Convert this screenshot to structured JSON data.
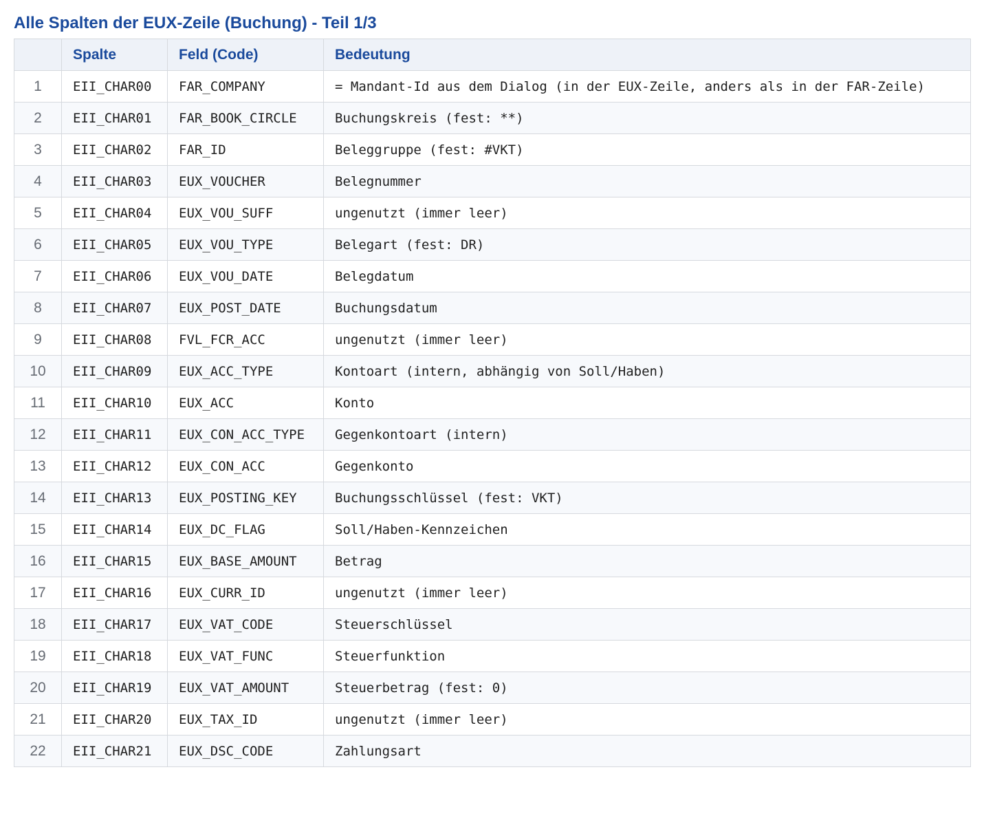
{
  "title": "Alle Spalten der EUX-Zeile (Buchung) - Teil 1/3",
  "table": {
    "headers": [
      "",
      "Spalte",
      "Feld (Code)",
      "Bedeutung"
    ],
    "rows": [
      {
        "num": "1",
        "spalte": "EII_CHAR00",
        "feld": "FAR_COMPANY",
        "bedeutung": "= Mandant-Id aus dem Dialog (in der EUX-Zeile, anders als in der FAR-Zeile)"
      },
      {
        "num": "2",
        "spalte": "EII_CHAR01",
        "feld": "FAR_BOOK_CIRCLE",
        "bedeutung": "Buchungskreis (fest: **)"
      },
      {
        "num": "3",
        "spalte": "EII_CHAR02",
        "feld": "FAR_ID",
        "bedeutung": "Beleggruppe (fest: #VKT)"
      },
      {
        "num": "4",
        "spalte": "EII_CHAR03",
        "feld": "EUX_VOUCHER",
        "bedeutung": "Belegnummer"
      },
      {
        "num": "5",
        "spalte": "EII_CHAR04",
        "feld": "EUX_VOU_SUFF",
        "bedeutung": "ungenutzt (immer leer)"
      },
      {
        "num": "6",
        "spalte": "EII_CHAR05",
        "feld": "EUX_VOU_TYPE",
        "bedeutung": "Belegart (fest: DR)"
      },
      {
        "num": "7",
        "spalte": "EII_CHAR06",
        "feld": "EUX_VOU_DATE",
        "bedeutung": "Belegdatum"
      },
      {
        "num": "8",
        "spalte": "EII_CHAR07",
        "feld": "EUX_POST_DATE",
        "bedeutung": "Buchungsdatum"
      },
      {
        "num": "9",
        "spalte": "EII_CHAR08",
        "feld": "FVL_FCR_ACC",
        "bedeutung": "ungenutzt (immer leer)"
      },
      {
        "num": "10",
        "spalte": "EII_CHAR09",
        "feld": "EUX_ACC_TYPE",
        "bedeutung": "Kontoart (intern, abhängig von Soll/Haben)"
      },
      {
        "num": "11",
        "spalte": "EII_CHAR10",
        "feld": "EUX_ACC",
        "bedeutung": "Konto"
      },
      {
        "num": "12",
        "spalte": "EII_CHAR11",
        "feld": "EUX_CON_ACC_TYPE",
        "bedeutung": "Gegenkontoart (intern)"
      },
      {
        "num": "13",
        "spalte": "EII_CHAR12",
        "feld": "EUX_CON_ACC",
        "bedeutung": "Gegenkonto"
      },
      {
        "num": "14",
        "spalte": "EII_CHAR13",
        "feld": "EUX_POSTING_KEY",
        "bedeutung": "Buchungsschlüssel (fest: VKT)"
      },
      {
        "num": "15",
        "spalte": "EII_CHAR14",
        "feld": "EUX_DC_FLAG",
        "bedeutung": "Soll/Haben-Kennzeichen"
      },
      {
        "num": "16",
        "spalte": "EII_CHAR15",
        "feld": "EUX_BASE_AMOUNT",
        "bedeutung": "Betrag"
      },
      {
        "num": "17",
        "spalte": "EII_CHAR16",
        "feld": "EUX_CURR_ID",
        "bedeutung": "ungenutzt (immer leer)"
      },
      {
        "num": "18",
        "spalte": "EII_CHAR17",
        "feld": "EUX_VAT_CODE",
        "bedeutung": "Steuerschlüssel"
      },
      {
        "num": "19",
        "spalte": "EII_CHAR18",
        "feld": "EUX_VAT_FUNC",
        "bedeutung": "Steuerfunktion"
      },
      {
        "num": "20",
        "spalte": "EII_CHAR19",
        "feld": "EUX_VAT_AMOUNT",
        "bedeutung": "Steuerbetrag (fest: 0)"
      },
      {
        "num": "21",
        "spalte": "EII_CHAR20",
        "feld": "EUX_TAX_ID",
        "bedeutung": "ungenutzt (immer leer)"
      },
      {
        "num": "22",
        "spalte": "EII_CHAR21",
        "feld": "EUX_DSC_CODE",
        "bedeutung": "Zahlungsart"
      }
    ]
  }
}
